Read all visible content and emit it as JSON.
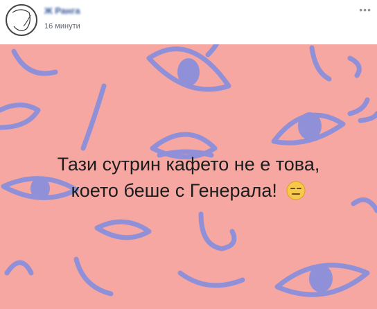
{
  "post": {
    "author": "Ж Ранга",
    "timestamp": "16 минути",
    "more_label": "•••"
  },
  "image": {
    "line1": "Тази сутрин кафето не е това,",
    "line2": "което беше с Генерала!",
    "emoji": "expressionless-face-emoji",
    "colors": {
      "background": "#f7a7a1",
      "doodle": "#8f90d8",
      "text": "#1d1d1d"
    }
  }
}
